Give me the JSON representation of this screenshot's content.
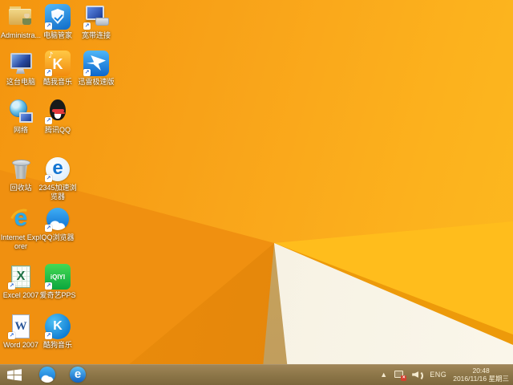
{
  "wallpaper": {
    "description": "Windows 8.1 default orange geometric wallpaper with white fold triangle at bottom right",
    "colors": {
      "base_orange": "#F9A51A",
      "bright_yellow_facet": "#FFBD1C",
      "dark_orange_facet": "#E68A0C",
      "tan_shadow_facet": "#C9A55F",
      "white_facet": "#F6F1E2"
    }
  },
  "desktop": {
    "icons": [
      {
        "id": "administrator",
        "label": "Administra...",
        "row": 0,
        "col": 0,
        "shortcut": false
      },
      {
        "id": "pc-manager",
        "label": "电脑管家",
        "row": 0,
        "col": 1,
        "shortcut": true
      },
      {
        "id": "broadband",
        "label": "宽带连接",
        "row": 0,
        "col": 2,
        "shortcut": true
      },
      {
        "id": "this-pc",
        "label": "这台电脑",
        "row": 1,
        "col": 0,
        "shortcut": false
      },
      {
        "id": "kuwo",
        "label": "酷我音乐",
        "row": 1,
        "col": 1,
        "shortcut": true
      },
      {
        "id": "thunder",
        "label": "迅雷极速版",
        "row": 1,
        "col": 2,
        "shortcut": true
      },
      {
        "id": "network",
        "label": "网络",
        "row": 2,
        "col": 0,
        "shortcut": false
      },
      {
        "id": "qq",
        "label": "腾讯QQ",
        "row": 2,
        "col": 1,
        "shortcut": true
      },
      {
        "id": "recycle-bin",
        "label": "回收站",
        "row": 3,
        "col": 0,
        "shortcut": false
      },
      {
        "id": "e2345",
        "label": "2345加速浏览器",
        "row": 3,
        "col": 1,
        "shortcut": true
      },
      {
        "id": "ie",
        "label": "Internet Explorer",
        "row": 4,
        "col": 0,
        "shortcut": false
      },
      {
        "id": "qq-browser",
        "label": "QQ浏览器",
        "row": 4,
        "col": 1,
        "shortcut": true
      },
      {
        "id": "excel",
        "label": "Excel 2007",
        "row": 5,
        "col": 0,
        "shortcut": true
      },
      {
        "id": "iqiyi",
        "label": "爱奇艺PPS",
        "row": 5,
        "col": 1,
        "shortcut": true
      },
      {
        "id": "word",
        "label": "Word 2007",
        "row": 6,
        "col": 0,
        "shortcut": true
      },
      {
        "id": "kugou",
        "label": "酷狗音乐",
        "row": 6,
        "col": 1,
        "shortcut": true
      }
    ]
  },
  "taskbar": {
    "pinned": [
      {
        "id": "qq-browser"
      },
      {
        "id": "e-browser"
      }
    ],
    "tray": {
      "language": "ENG",
      "time": "20:48",
      "date": "2016/11/16 星期三",
      "network_status": "disconnected"
    },
    "colors": {
      "background": "#8F784A"
    }
  }
}
